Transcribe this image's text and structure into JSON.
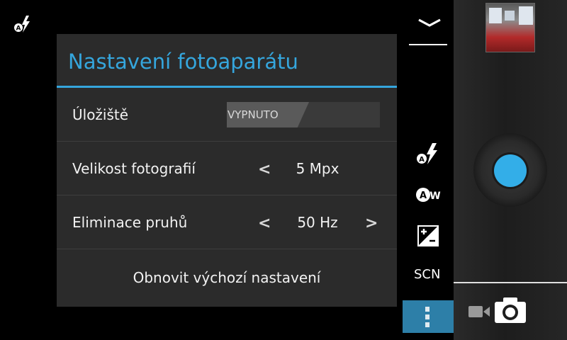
{
  "dialog": {
    "title": "Nastavení fotoaparátu",
    "storage": {
      "label": "Úložiště",
      "toggle_state": "VYPNUTO"
    },
    "photo_size": {
      "label": "Velikost fotografií",
      "value": "5 Mpx",
      "prev": "<"
    },
    "antibanding": {
      "label": "Eliminace pruhů",
      "value": "50 Hz",
      "prev": "<",
      "next": ">"
    },
    "reset_label": "Obnovit výchozí nastavení"
  },
  "side": {
    "scn_label": "SCN"
  },
  "colors": {
    "accent": "#35a6dd",
    "shutter": "#33aee8",
    "more_button": "#2d7fa8"
  }
}
